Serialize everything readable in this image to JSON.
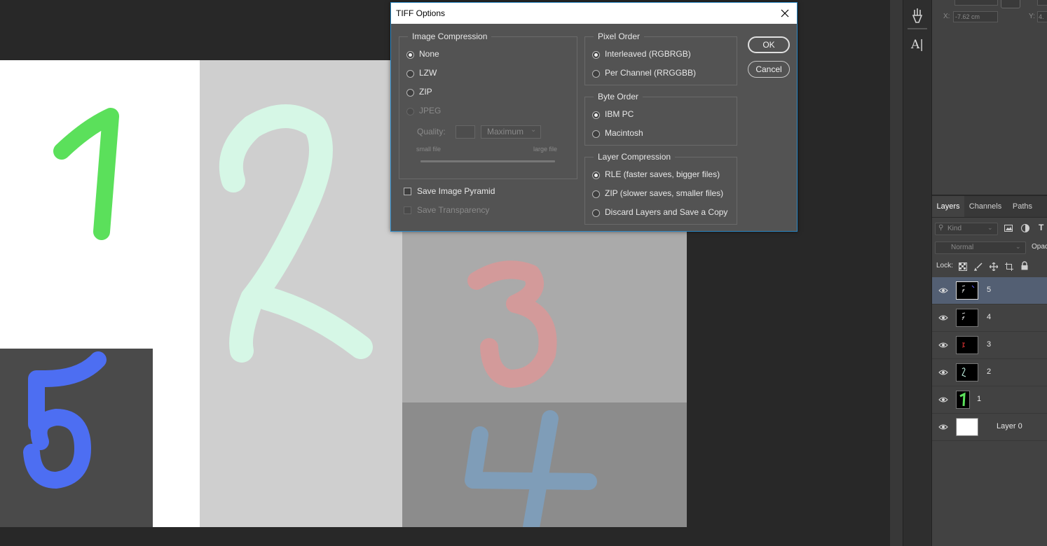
{
  "dialog": {
    "title": "TIFF Options",
    "ok_label": "OK",
    "cancel_label": "Cancel",
    "image_compression": {
      "label": "Image Compression",
      "options": [
        "None",
        "LZW",
        "ZIP",
        "JPEG"
      ],
      "selected": "None",
      "quality_label": "Quality:",
      "quality_value": "",
      "quality_select": "Maximum",
      "small_file": "small file",
      "large_file": "large file"
    },
    "pixel_order": {
      "label": "Pixel Order",
      "options": [
        "Interleaved (RGBRGB)",
        "Per Channel (RRGGBB)"
      ],
      "selected": "Interleaved (RGBRGB)"
    },
    "byte_order": {
      "label": "Byte Order",
      "options": [
        "IBM PC",
        "Macintosh"
      ],
      "selected": "IBM PC"
    },
    "layer_compression": {
      "label": "Layer Compression",
      "options": [
        "RLE (faster saves, bigger files)",
        "ZIP (slower saves, smaller files)",
        "Discard Layers and Save a Copy"
      ],
      "selected": "RLE (faster saves, bigger files)"
    },
    "save_image_pyramid": "Save Image Pyramid",
    "save_transparency": "Save Transparency"
  },
  "properties": {
    "x_label": "X:",
    "x_value": "-7.62 cm",
    "y_label": "Y:",
    "y_value": "4."
  },
  "layers_panel": {
    "tabs": [
      "Layers",
      "Channels",
      "Paths"
    ],
    "active_tab": "Layers",
    "filter_kind": "Kind",
    "blend_mode": "Normal",
    "opacity_label": "Opac",
    "lock_label": "Lock:",
    "layers": [
      {
        "name": "5",
        "selected": true
      },
      {
        "name": "4",
        "selected": false
      },
      {
        "name": "3",
        "selected": false
      },
      {
        "name": "2",
        "selected": false
      },
      {
        "name": "1",
        "selected": false
      },
      {
        "name": "Layer 0",
        "selected": false
      }
    ]
  },
  "canvas": {
    "digits": [
      "1",
      "2",
      "3",
      "4",
      "5"
    ],
    "colors": {
      "digit1": "#5be05b",
      "digit2": "#d6f7e6",
      "digit3": "#d39a9a",
      "digit4": "#7f9db8",
      "digit5": "#4d6ef2"
    }
  }
}
